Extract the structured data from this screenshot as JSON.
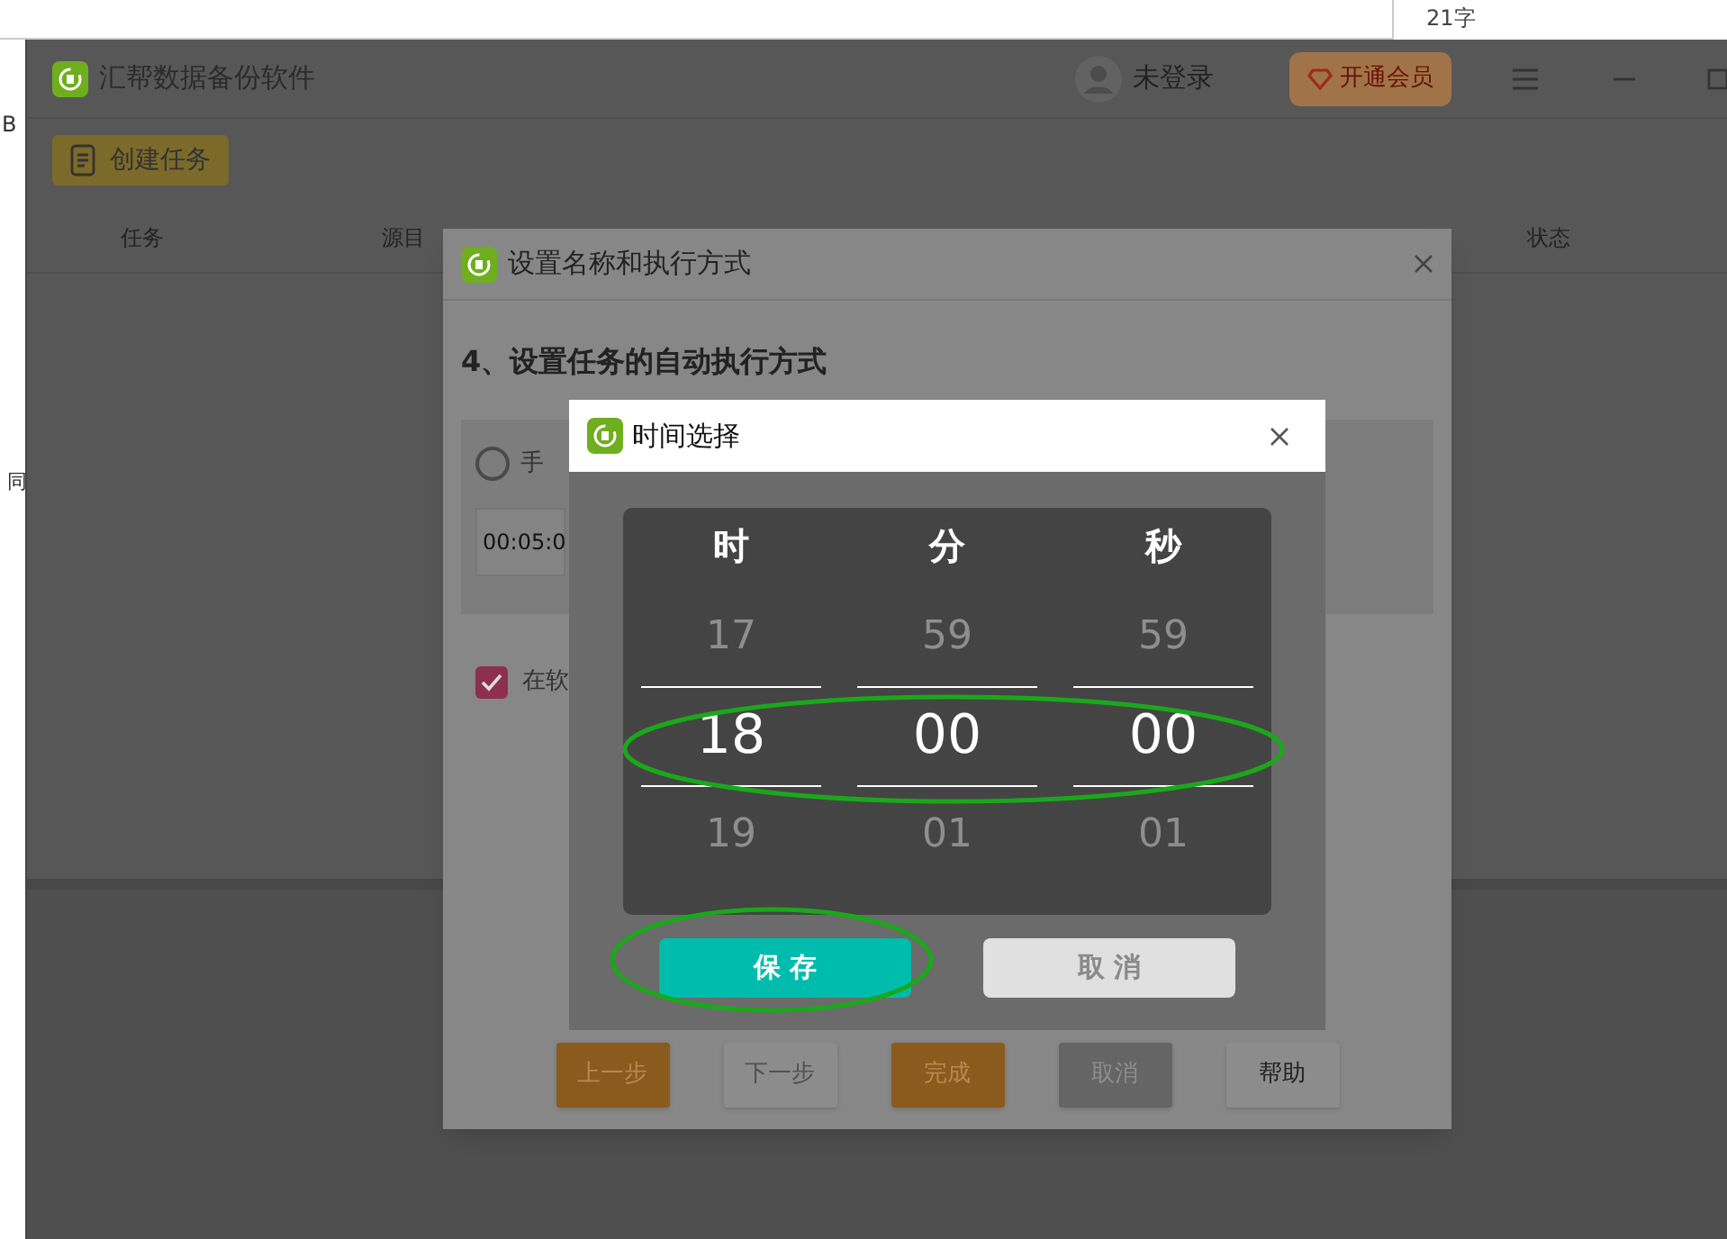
{
  "background": {
    "counter": "21字",
    "side_texts": [
      "B",
      "同"
    ]
  },
  "app": {
    "title": "汇帮数据备份软件",
    "user": "未登录",
    "vip_button": "开通会员",
    "create_button": "创建任务",
    "columns": [
      "任务",
      "源目",
      "状态"
    ]
  },
  "dialog": {
    "title": "设置名称和执行方式",
    "heading": "4、设置任务的自动执行方式",
    "radio": {
      "label": "手",
      "selected": false
    },
    "time_field": {
      "value": "00:05:0"
    },
    "checkbox": {
      "label": "在软",
      "checked": true
    },
    "buttons": [
      {
        "label": "上一步",
        "kind": "primary"
      },
      {
        "label": "下一步",
        "kind": "disabled"
      },
      {
        "label": "完成",
        "kind": "primary"
      },
      {
        "label": "取消",
        "kind": "dark"
      },
      {
        "label": "帮助",
        "kind": "light"
      }
    ]
  },
  "time_picker": {
    "title": "时间选择",
    "columns": [
      {
        "header": "时",
        "above": "17",
        "value": "18",
        "below": "19"
      },
      {
        "header": "分",
        "above": "59",
        "value": "00",
        "below": "01"
      },
      {
        "header": "秒",
        "above": "59",
        "value": "00",
        "below": "01"
      }
    ],
    "save": "保 存",
    "cancel": "取 消"
  }
}
